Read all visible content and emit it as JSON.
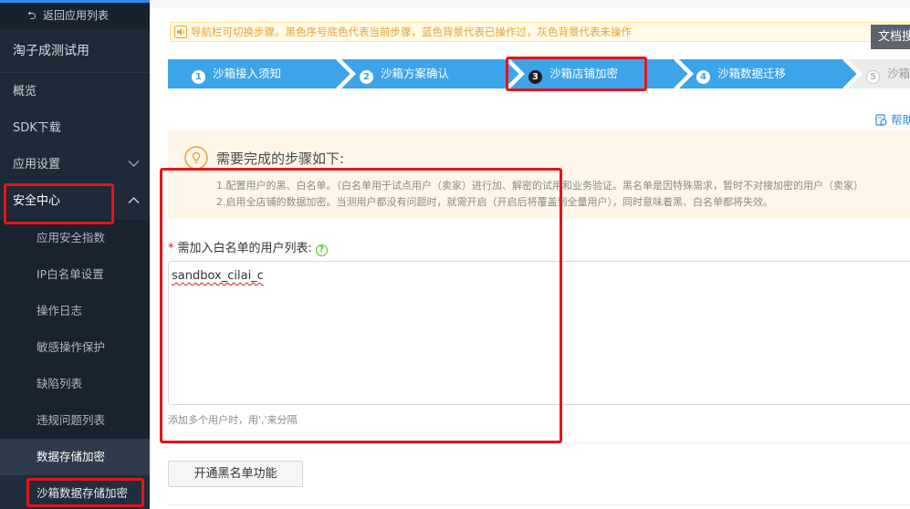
{
  "sidebar": {
    "back_label": "返回应用列表",
    "back_icon": "return-arrow-icon",
    "app_name": "淘子成测试用",
    "items": [
      {
        "label": "概览"
      },
      {
        "label": "SDK下载"
      },
      {
        "label": "应用设置",
        "icon": "chevron-down-icon"
      },
      {
        "label": "安全中心",
        "icon": "chevron-up-icon"
      }
    ],
    "security_sub_items": [
      {
        "label": "应用安全指数"
      },
      {
        "label": "IP白名单设置"
      },
      {
        "label": "操作日志"
      },
      {
        "label": "敏感操作保护"
      },
      {
        "label": "缺陷列表"
      },
      {
        "label": "违规问题列表"
      },
      {
        "label": "数据存储加密"
      },
      {
        "label": "沙箱数据存储加密"
      }
    ]
  },
  "notice": {
    "text": "导航栏可切换步骤。黑色序号底色代表当前步骤，蓝色背景代表已操作过，灰色背景代表未操作",
    "icon": "speaker-icon"
  },
  "doc_button": "文档搜",
  "steps": [
    {
      "num": "1",
      "label": "沙箱接入须知",
      "state": "done"
    },
    {
      "num": "2",
      "label": "沙箱方案确认",
      "state": "done"
    },
    {
      "num": "3",
      "label": "沙箱店铺加密",
      "state": "current"
    },
    {
      "num": "4",
      "label": "沙箱数据迁移",
      "state": "done"
    },
    {
      "num": "5",
      "label": "沙箱验证",
      "state": "pending"
    }
  ],
  "help_link": "帮助",
  "info": {
    "title": "需要完成的步骤如下:",
    "lines": [
      "1.配置用户的黑、白名单。（白名单用于试点用户（卖家）进行加、解密的试用和业务验证。黑名单是因特殊需求，暂时不对接加密的用户（卖家）",
      "2.启用全店铺的数据加密。当测用户都没有问题时，就需开启（开启后将覆盖到全量用户），同时意味着黑、白名单都将失效。"
    ],
    "icon": "lightbulb-icon"
  },
  "whitelist": {
    "label": "需加入白名单的用户列表:",
    "required_mark": "*",
    "value": "sandbox_cilai_c",
    "hint": "添加多个用户时，用','来分隔"
  },
  "blacklist_button": "开通黑名单功能",
  "colors": {
    "sidebar_bg": "#1e2a38",
    "step_done": "#3ca4e8",
    "step_pending": "#ececec",
    "highlight": "#e3141e",
    "notice_text": "#e6a23c"
  }
}
